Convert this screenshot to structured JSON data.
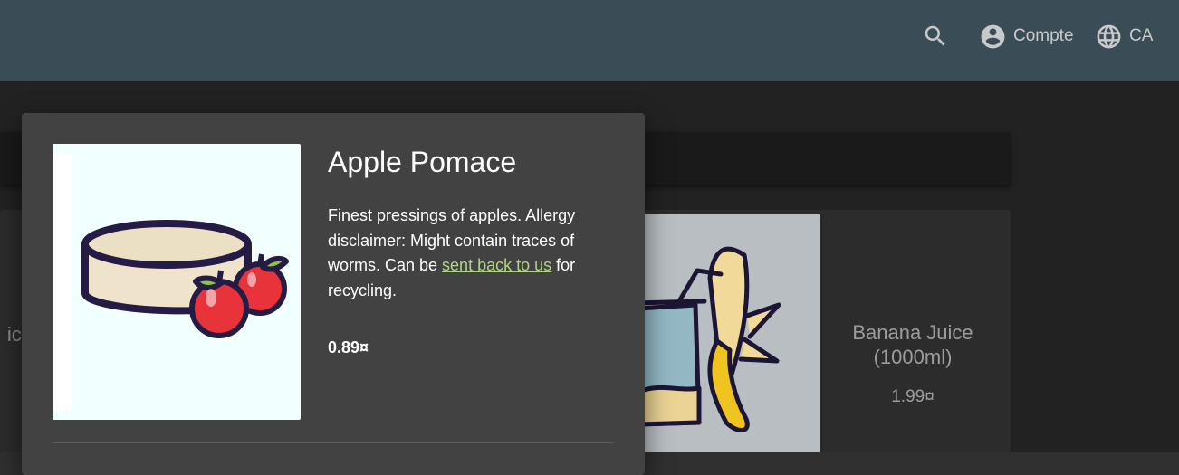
{
  "topbar": {
    "search_icon": "search-icon",
    "account_icon": "account-circle-icon",
    "account_label": "Compte",
    "language_icon": "globe-icon",
    "language_label": "CA"
  },
  "background": {
    "left_card_name": "ice\nl)",
    "banana_card": {
      "name": "Banana Juice\n(1000ml)",
      "price": "1.99¤"
    }
  },
  "dialog": {
    "image_icon": "apple-pomace-image",
    "title": "Apple Pomace",
    "description_before": "Finest pressings of apples. Allergy disclaimer: Might contain traces of worms. Can be ",
    "description_link": "sent back to us",
    "description_after": " for recycling.",
    "price": "0.89¤"
  },
  "colors": {
    "toolbar": "#3a4c55",
    "dialog": "#424242",
    "link": "#aed581"
  }
}
